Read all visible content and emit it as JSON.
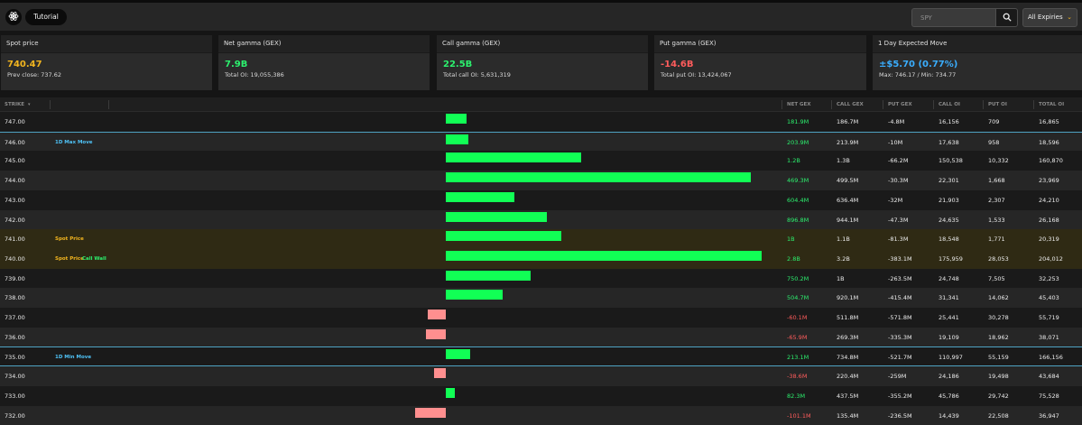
{
  "header": {
    "logo_icon": "atom-icon",
    "tutorial_label": "Tutorial",
    "search_placeholder": "SPY",
    "search_icon": "search-icon",
    "expiry_label": "All Expiries",
    "expiry_icon": "chevron-down-icon"
  },
  "cards": [
    {
      "title": "Spot price",
      "value": "740.47",
      "sub": "Prev close: 737.62",
      "color": "#f2b51f"
    },
    {
      "title": "Net gamma (GEX)",
      "value": "7.9B",
      "sub": "Total OI: 19,055,386",
      "color": "#2cf06e"
    },
    {
      "title": "Call gamma (GEX)",
      "value": "22.5B",
      "sub": "Total call OI: 5,631,319",
      "color": "#2cf06e"
    },
    {
      "title": "Put gamma (GEX)",
      "value": "-14.6B",
      "sub": "Total put OI: 13,424,067",
      "color": "#ff5c5c"
    },
    {
      "title": "1 Day Expected Move",
      "value": "±$5.70 (0.77%)",
      "sub": "Max: 746.17 / Min: 734.77",
      "color": "#3aaeff"
    }
  ],
  "table": {
    "columns": {
      "strike": "STRIKE",
      "net_gex": "NET GEX",
      "call_gex": "CALL GEX",
      "put_gex": "PUT GEX",
      "call_oi": "CALL OI",
      "put_oi": "PUT OI",
      "total_oi": "TOTAL OI"
    },
    "sort_icon": "sort-down-icon",
    "rows": [
      {
        "strike": "747.00",
        "tags": [],
        "net_gex": "181.9M",
        "net_gex_value": 181.9,
        "call_gex": "186.7M",
        "put_gex": "-4.8M",
        "call_oi": "16,156",
        "put_oi": "709",
        "total_oi": "16,865"
      },
      {
        "strike": "746.00",
        "tags": [
          {
            "text": "1D Max Move",
            "color": "blue"
          }
        ],
        "net_gex": "203.9M",
        "net_gex_value": 203.9,
        "call_gex": "213.9M",
        "put_gex": "-10M",
        "call_oi": "17,638",
        "put_oi": "958",
        "total_oi": "18,596"
      },
      {
        "strike": "745.00",
        "tags": [],
        "net_gex": "1.2B",
        "net_gex_value": 1200,
        "call_gex": "1.3B",
        "put_gex": "-66.2M",
        "call_oi": "150,538",
        "put_oi": "10,332",
        "total_oi": "160,870"
      },
      {
        "strike": "744.00",
        "tags": [],
        "net_gex": "469.3M",
        "net_gex_value": 2700,
        "call_gex": "499.5M",
        "put_gex": "-30.3M",
        "call_oi": "22,301",
        "put_oi": "1,668",
        "total_oi": "23,969"
      },
      {
        "strike": "743.00",
        "tags": [],
        "net_gex": "604.4M",
        "net_gex_value": 604.4,
        "call_gex": "636.4M",
        "put_gex": "-32M",
        "call_oi": "21,903",
        "put_oi": "2,307",
        "total_oi": "24,210"
      },
      {
        "strike": "742.00",
        "tags": [],
        "net_gex": "896.8M",
        "net_gex_value": 896.8,
        "call_gex": "944.1M",
        "put_gex": "-47.3M",
        "call_oi": "24,635",
        "put_oi": "1,533",
        "total_oi": "26,168"
      },
      {
        "strike": "741.00",
        "tags": [
          {
            "text": "Spot Price",
            "color": "yellow"
          }
        ],
        "net_gex": "1B",
        "net_gex_value": 1020,
        "call_gex": "1.1B",
        "put_gex": "-81.3M",
        "call_oi": "18,548",
        "put_oi": "1,771",
        "total_oi": "20,319"
      },
      {
        "strike": "740.00",
        "tags": [
          {
            "text": "Spot Price",
            "color": "yellow"
          },
          {
            "text": "Call Wall",
            "color": "green"
          }
        ],
        "net_gex": "2.8B",
        "net_gex_value": 2800,
        "call_gex": "3.2B",
        "put_gex": "-383.1M",
        "call_oi": "175,959",
        "put_oi": "28,053",
        "total_oi": "204,012"
      },
      {
        "strike": "739.00",
        "tags": [],
        "net_gex": "750.2M",
        "net_gex_value": 750.2,
        "call_gex": "1B",
        "put_gex": "-263.5M",
        "call_oi": "24,748",
        "put_oi": "7,505",
        "total_oi": "32,253"
      },
      {
        "strike": "738.00",
        "tags": [],
        "net_gex": "504.7M",
        "net_gex_value": 504.7,
        "call_gex": "920.1M",
        "put_gex": "-415.4M",
        "call_oi": "31,341",
        "put_oi": "14,062",
        "total_oi": "45,403"
      },
      {
        "strike": "737.00",
        "tags": [],
        "net_gex": "-60.1M",
        "net_gex_value": -60.1,
        "call_gex": "511.8M",
        "put_gex": "-571.8M",
        "call_oi": "25,441",
        "put_oi": "30,278",
        "total_oi": "55,719"
      },
      {
        "strike": "736.00",
        "tags": [],
        "net_gex": "-65.9M",
        "net_gex_value": -65.9,
        "call_gex": "269.3M",
        "put_gex": "-335.3M",
        "call_oi": "19,109",
        "put_oi": "18,962",
        "total_oi": "38,071"
      },
      {
        "strike": "735.00",
        "tags": [
          {
            "text": "1D Min Move",
            "color": "blue"
          }
        ],
        "net_gex": "213.1M",
        "net_gex_value": 213.1,
        "call_gex": "734.8M",
        "put_gex": "-521.7M",
        "call_oi": "110,997",
        "put_oi": "55,159",
        "total_oi": "166,156"
      },
      {
        "strike": "734.00",
        "tags": [],
        "net_gex": "-38.6M",
        "net_gex_value": -38.6,
        "call_gex": "220.4M",
        "put_gex": "-259M",
        "call_oi": "24,186",
        "put_oi": "19,498",
        "total_oi": "43,684"
      },
      {
        "strike": "733.00",
        "tags": [],
        "net_gex": "82.3M",
        "net_gex_value": 82.3,
        "call_gex": "437.5M",
        "put_gex": "-355.2M",
        "call_oi": "45,786",
        "put_oi": "29,742",
        "total_oi": "75,528"
      },
      {
        "strike": "732.00",
        "tags": [],
        "net_gex": "-101.1M",
        "net_gex_value": -101.1,
        "call_gex": "135.4M",
        "put_gex": "-236.5M",
        "call_oi": "14,439",
        "put_oi": "22,508",
        "total_oi": "36,947"
      }
    ]
  },
  "colors": {
    "positive_bar": "#11ff55",
    "negative_bar": "#ff8f8f",
    "positive_text": "#2cf06e",
    "negative_text": "#ff5c5c",
    "accent_yellow": "#f2b51f",
    "accent_blue": "#3aaeff"
  }
}
